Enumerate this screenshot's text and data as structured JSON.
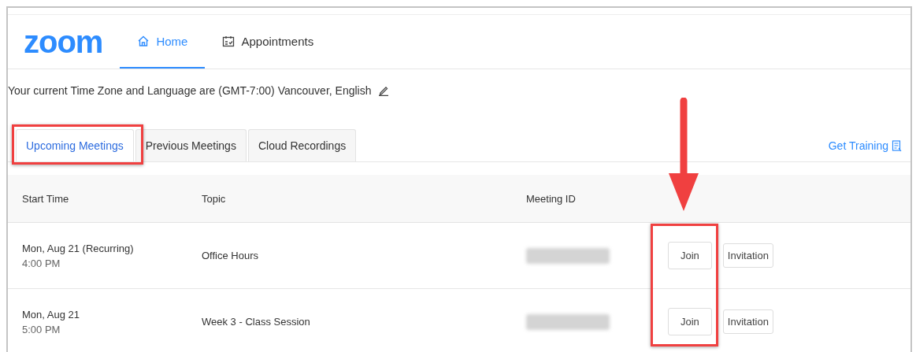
{
  "nav": [
    {
      "label": "Home",
      "selected": true
    },
    {
      "label": "Appointments",
      "selected": false
    }
  ],
  "logo": "zoom",
  "timezone_notice": "Your current Time Zone and Language are (GMT-7:00) Vancouver, English",
  "tabs": [
    {
      "label": "Upcoming Meetings",
      "selected": true
    },
    {
      "label": "Previous Meetings",
      "selected": false
    },
    {
      "label": "Cloud Recordings",
      "selected": false
    }
  ],
  "get_training": "Get Training",
  "table": {
    "columns": [
      "Start Time",
      "Topic",
      "Meeting ID"
    ],
    "rows": [
      {
        "date": "Mon, Aug 21 (Recurring)",
        "time": "4:00 PM",
        "topic": "Office Hours",
        "buttons": [
          "Join",
          "Invitation"
        ]
      },
      {
        "date": "Mon, Aug 21",
        "time": "5:00 PM",
        "topic": "Week 3 - Class Session",
        "buttons": [
          "Join",
          "Invitation"
        ]
      }
    ]
  }
}
